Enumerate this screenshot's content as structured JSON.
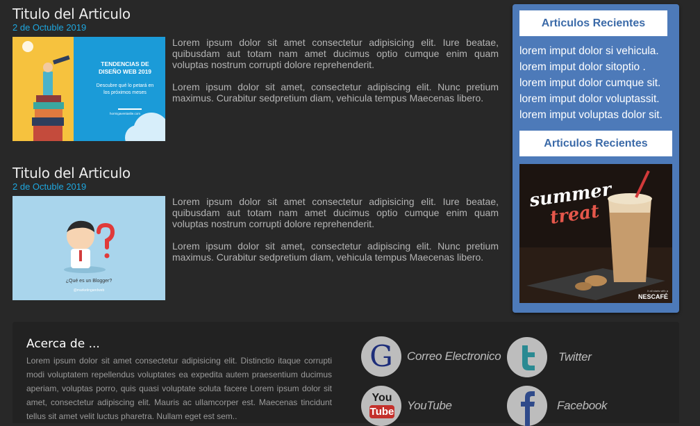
{
  "articles": [
    {
      "title": "Titulo del Articulo",
      "date": "2 de Octuble 2019",
      "paragraphs": [
        "Lorem ipsum dolor sit amet consectetur adipisicing elit. Iure beatae, quibusdam aut totam nam amet ducimus optio cumque enim quam voluptas nostrum corrupti dolore reprehenderit.",
        "Lorem ipsum dolor sit amet, consectetur adipiscing elit. Nunc pretium maximus. Curabitur sedpretium diam, vehicula tempus Maecenas libero."
      ],
      "thumb": {
        "line1": "TENDENCIAS DE",
        "line2": "DISEÑO WEB 2019",
        "line3": "Descubre qué lo petará en",
        "line4": "los próximos meses",
        "url": "hormigaventaslte.com"
      }
    },
    {
      "title": "Titulo del Articulo",
      "date": "2 de Octuble 2019",
      "paragraphs": [
        "Lorem ipsum dolor sit amet consectetur adipisicing elit. Iure beatae, quibusdam aut totam nam amet ducimus optio cumque enim quam voluptas nostrum corrupti dolore reprehenderit.",
        "Lorem ipsum dolor sit amet, consectetur adipiscing elit. Nunc pretium maximus. Curabitur sedpretium diam, vehicula tempus Maecenas libero."
      ],
      "thumb": {
        "caption": "¿Qué es un Blogger?",
        "handle": "@marketingandweb"
      }
    }
  ],
  "sidebar": {
    "heading1": "Articulos Recientes",
    "items": [
      "lorem imput dolor si vehicula.",
      "lorem imput dolor sitoptio .",
      "lorem imput dolor cumque sit.",
      "lorem imput dolor voluptassit.",
      "lorem imput voluptas dolor sit."
    ],
    "heading2": "Articulos Recientes",
    "promo": {
      "line1": "summer",
      "line2": "treat",
      "brand": "NESCAFÉ",
      "fine": "It all starts with a"
    }
  },
  "footer": {
    "about_title": "Acerca de ...",
    "about_text": "Lorem ipsum dolor sit amet consectetur adipisicing elit. Distinctio itaque corrupti modi voluptatem repellendus voluptates ea expedita autem praesentium ducimus aperiam, voluptas porro, quis quasi voluptate soluta facere Lorem ipsum dolor sit amet, consectetur adipiscing elit. Mauris ac ullamcorper est. Maecenas tincidunt tellus sit amet velit luctus pharetra. Nullam eget est sem..",
    "social": {
      "email": "Correo Electronico",
      "twitter": "Twitter",
      "youtube": "YouTube",
      "facebook": "Facebook",
      "google_glyph": "G",
      "yt_top": "You",
      "yt_bottom": "Tube"
    }
  },
  "colors": {
    "background": "#282828",
    "accent_blue": "#4d7ab9",
    "date_cyan": "#1ea7df",
    "twitter": "#2a8a92",
    "youtube_red": "#c4302b",
    "facebook": "#3b5998"
  }
}
